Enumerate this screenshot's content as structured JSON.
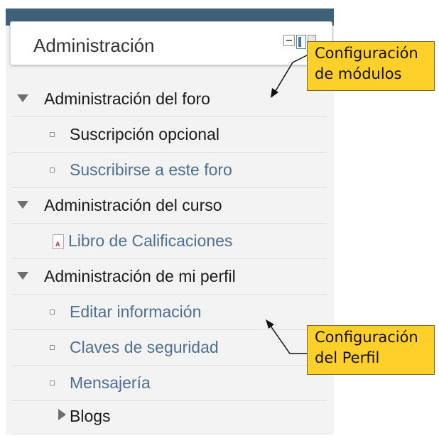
{
  "block": {
    "title": "Administración",
    "sections": [
      {
        "label": "Administración del foro",
        "items": [
          {
            "label": "Suscripción opcional"
          },
          {
            "label": "Suscribirse a este foro"
          }
        ]
      },
      {
        "label": "Administración del curso",
        "items": [
          {
            "label": "Libro de Calificaciones",
            "icon": "gradebook-icon"
          }
        ]
      },
      {
        "label": "Administración de mi perfil",
        "items": [
          {
            "label": "Editar información"
          },
          {
            "label": "Claves de seguridad"
          },
          {
            "label": "Mensajería"
          },
          {
            "label": "Blogs"
          }
        ]
      }
    ],
    "gradebook_icon_letter": "A"
  },
  "callouts": {
    "modules": {
      "line1": "Configuración",
      "line2": "de módulos"
    },
    "profile": {
      "line1": "Configuración",
      "line2": "del Perfil"
    }
  },
  "colors": {
    "header_bar": "#3e6177",
    "link": "#4f6f8f",
    "callout_bg": "#ffd02a"
  }
}
